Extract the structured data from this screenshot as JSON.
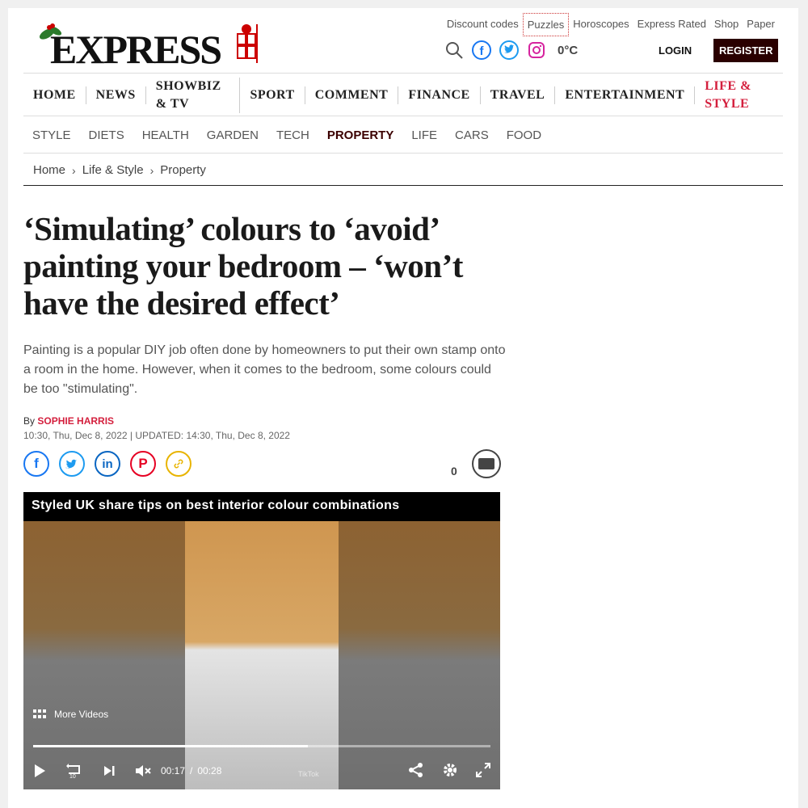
{
  "brand": {
    "name": "EXPRESS"
  },
  "toplinks": [
    "Discount codes",
    "Puzzles",
    "Horoscopes",
    "Express Rated",
    "Shop",
    "Paper"
  ],
  "header": {
    "temperature": "0°C",
    "login": "LOGIN",
    "register": "REGISTER"
  },
  "mainnav": [
    "HOME",
    "NEWS",
    "SHOWBIZ & TV",
    "SPORT",
    "COMMENT",
    "FINANCE",
    "TRAVEL",
    "ENTERTAINMENT",
    "LIFE & STYLE"
  ],
  "subnav": [
    "STYLE",
    "DIETS",
    "HEALTH",
    "GARDEN",
    "TECH",
    "PROPERTY",
    "LIFE",
    "CARS",
    "FOOD"
  ],
  "breadcrumb": [
    "Home",
    "Life & Style",
    "Property"
  ],
  "article": {
    "title": "‘Simulating’ colours to ‘avoid’ painting your bedroom – ‘won’t have the desired effect’",
    "standfirst": "Painting is a popular DIY job often done by homeowners to put their own stamp onto a room in the home. However, when it comes to the bedroom, some colours could be too \"stimulating\".",
    "by": "By",
    "author": "SOPHIE HARRIS",
    "dates": "10:30, Thu, Dec 8, 2022 | UPDATED: 14:30, Thu, Dec 8, 2022",
    "comment_count": "0"
  },
  "share_icons": [
    "facebook-icon",
    "twitter-icon",
    "linkedin-icon",
    "pinterest-icon",
    "link-icon"
  ],
  "video": {
    "title": "Styled UK share tips on best interior colour combinations",
    "more_videos": "More Videos",
    "current_time": "00:17",
    "separator": "/",
    "duration": "00:28",
    "progress": 0.6,
    "watermark": "TikTok"
  },
  "colors": {
    "accent": "#d41f3d",
    "register_bg": "#2a0000",
    "property_active": "#3b0000"
  }
}
